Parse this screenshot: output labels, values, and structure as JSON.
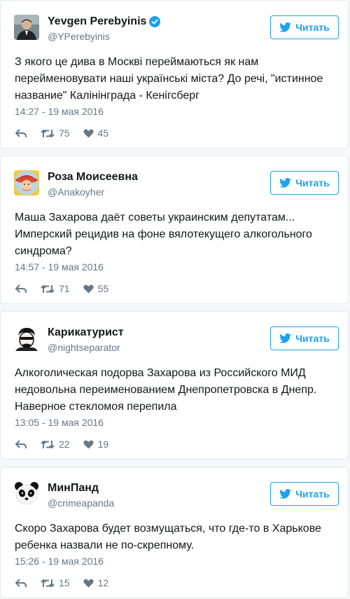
{
  "colors": {
    "accent": "#1da1f2",
    "verified": "#1da1f2",
    "muted": "#657786",
    "border": "#e1e8ed"
  },
  "tweets": [
    {
      "name": "Yevgen Perebyinis",
      "verified": true,
      "handle": "@YPerebyinis",
      "avatar_icon": "man-in-suit-avatar",
      "follow_label": "Читать",
      "text": "З якого це дива в Москві переймаються як нам перейменовувати наші українські міста? До речі, \"истинное название\" Калінінграда - Кенігсберг",
      "time": "14:27 - 19 мая 2016",
      "retweets": "75",
      "likes": "45"
    },
    {
      "name": "Роза Моисеевна",
      "verified": false,
      "handle": "@Anakoyher",
      "avatar_icon": "woman-with-hat-avatar",
      "follow_label": "Читать",
      "text": "Маша Захарова даёт советы украинским депутатам... Имперский рецидив на фоне вялотекущего алкогольного синдрома?",
      "time": "14:57 - 19 мая 2016",
      "retweets": "71",
      "likes": "55"
    },
    {
      "name": "Карикатурист",
      "verified": false,
      "handle": "@nightseparator",
      "avatar_icon": "cartoon-face-avatar",
      "follow_label": "Читать",
      "text": "Алкоголическая подорва Захарова из Российского МИД недовольна переименованием Днепропетровска в Днепр. Наверное стекломоя перепила",
      "time": "13:05 - 19 мая 2016",
      "retweets": "22",
      "likes": "19"
    },
    {
      "name": "МинПанд",
      "verified": false,
      "handle": "@crimeapanda",
      "avatar_icon": "panda-avatar",
      "follow_label": "Читать",
      "text": "Скоро Захарова будет возмущаться, что где-то в Харькове ребенка назвали не по-скрепному.",
      "time": "15:26 - 19 мая 2016",
      "retweets": "15",
      "likes": "12"
    }
  ]
}
